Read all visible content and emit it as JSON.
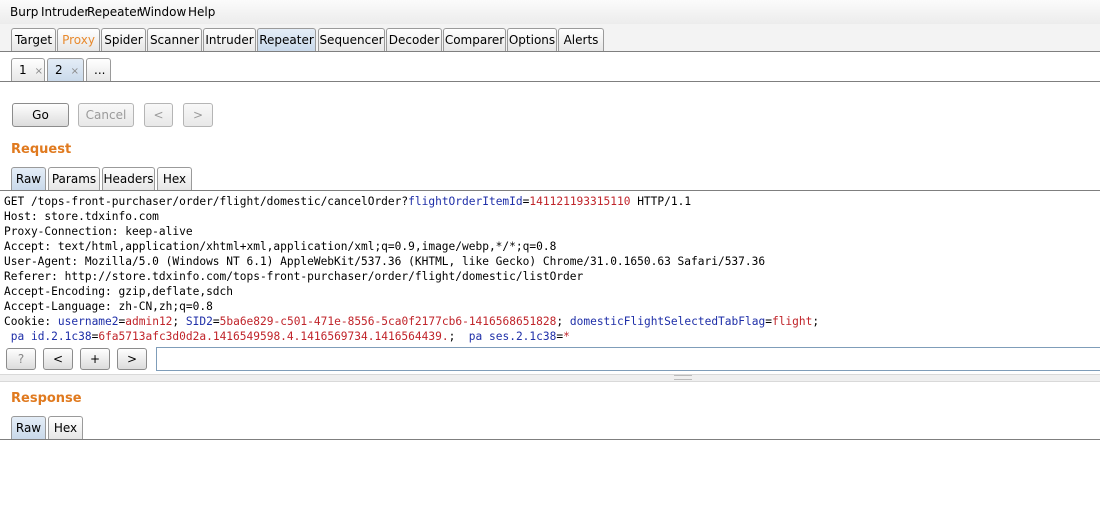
{
  "menu": [
    "Burp",
    "Intruder",
    "Repeater",
    "Window",
    "Help"
  ],
  "main_tabs": [
    "Target",
    "Proxy",
    "Spider",
    "Scanner",
    "Intruder",
    "Repeater",
    "Sequencer",
    "Decoder",
    "Comparer",
    "Options",
    "Alerts"
  ],
  "active_main_tab": "Repeater",
  "sub_tabs": [
    {
      "label": "1",
      "close": "×"
    },
    {
      "label": "2",
      "close": "×"
    },
    {
      "label": "...",
      "close": ""
    }
  ],
  "buttons": {
    "go": "Go",
    "cancel": "Cancel",
    "back": "<",
    "forward": ">"
  },
  "request": {
    "title": "Request",
    "tabs": [
      "Raw",
      "Params",
      "Headers",
      "Hex"
    ],
    "lines": {
      "l1": {
        "a": "GET /tops-front-purchaser/order/flight/domestic/cancelOrder?",
        "param": "flightOrderItemId",
        "eq": "=",
        "val": "141121193315110",
        "b": " HTTP/1.1"
      },
      "l2": "Host: store.tdxinfo.com",
      "l3": "Proxy-Connection: keep-alive",
      "l4": "Accept: text/html,application/xhtml+xml,application/xml;q=0.9,image/webp,*/*;q=0.8",
      "l5": "User-Agent: Mozilla/5.0 (Windows NT 6.1) AppleWebKit/537.36 (KHTML, like Gecko) Chrome/31.0.1650.63 Safari/537.36",
      "l6": "Referer: http://store.tdxinfo.com/tops-front-purchaser/order/flight/domestic/listOrder",
      "l7": "Accept-Encoding: gzip,deflate,sdch",
      "l8": "Accept-Language: zh-CN,zh;q=0.8",
      "l9": {
        "pre": "Cookie: ",
        "k1": "username2",
        "v1": "admin12",
        "k2": "SID2",
        "v2": "5ba6e829-c501-471e-8556-5ca0f2177cb6-1416568651828",
        "k3": "domesticFlightSelectedTabFlag",
        "v3": "flight"
      },
      "l10": {
        "k1": "pa id.2.1c38",
        "v1": "6fa5713afc3d0d2a.1416549598.4.1416569734.1416564439.",
        "k2": "pa ses.2.1c38",
        "v2": "*"
      }
    },
    "search_buttons": [
      "?",
      "<",
      "+",
      ">"
    ],
    "search_value": ""
  },
  "response": {
    "title": "Response",
    "tabs": [
      "Raw",
      "Hex"
    ]
  }
}
